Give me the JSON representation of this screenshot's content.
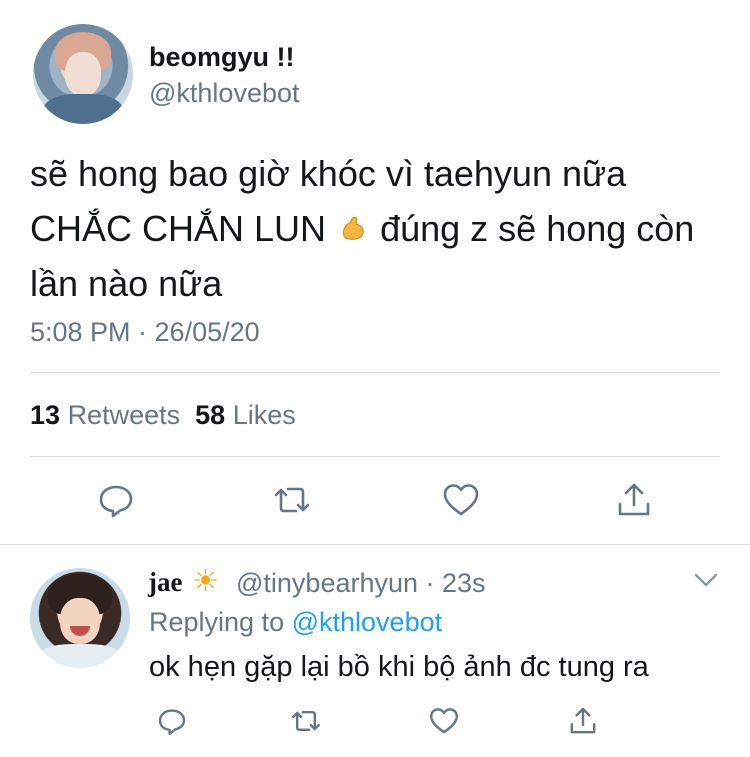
{
  "tweet": {
    "author": {
      "display_name": "beomgyu !!",
      "handle": "@kthlovebot"
    },
    "text_lines": [
      "sẽ hong bao giờ khóc vì taehyun nữa",
      "CHẮC CHẮN LUN",
      "đúng z sẽ hong còn",
      "lần nào nữa"
    ],
    "emoji": "flexed-biceps",
    "timestamp": "5:08 PM · 26/05/20",
    "stats": {
      "retweets_count": "13",
      "retweets_label": "Retweets",
      "likes_count": "58",
      "likes_label": "Likes"
    },
    "actions": [
      "reply-icon",
      "retweet-icon",
      "like-icon",
      "share-icon"
    ]
  },
  "reply": {
    "display_name": "jae",
    "emoji": "☀",
    "handle_and_time": "@tinybearhyun · 23s",
    "replying_prefix": "Replying to",
    "replying_handle": "@kthlovebot",
    "text": "ok hẹn gặp lại bồ khi bộ ảnh đc tung ra",
    "actions": [
      "reply-icon",
      "retweet-icon",
      "like-icon",
      "share-icon"
    ]
  },
  "colors": {
    "text_primary": "#14171a",
    "text_secondary": "#657786",
    "link": "#1da1f2",
    "divider": "#d9dee2"
  }
}
